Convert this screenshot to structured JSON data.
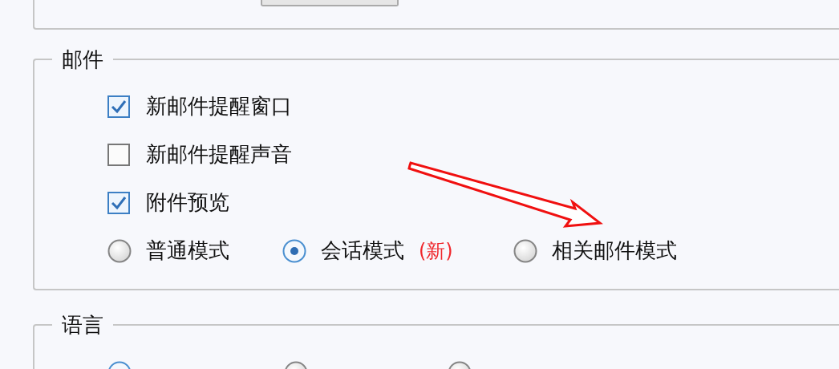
{
  "mail": {
    "title": "邮件",
    "options": [
      {
        "label": "新邮件提醒窗口",
        "checked": true
      },
      {
        "label": "新邮件提醒声音",
        "checked": false
      },
      {
        "label": "附件预览",
        "checked": true
      }
    ],
    "view_modes": [
      {
        "label": "普通模式",
        "selected": false
      },
      {
        "label": "会话模式",
        "badge": "(新)",
        "selected": true
      },
      {
        "label": "相关邮件模式",
        "selected": false
      }
    ]
  },
  "language": {
    "title": "语言",
    "options": [
      {
        "selected": true
      },
      {
        "selected": false
      },
      {
        "selected": false
      }
    ]
  }
}
